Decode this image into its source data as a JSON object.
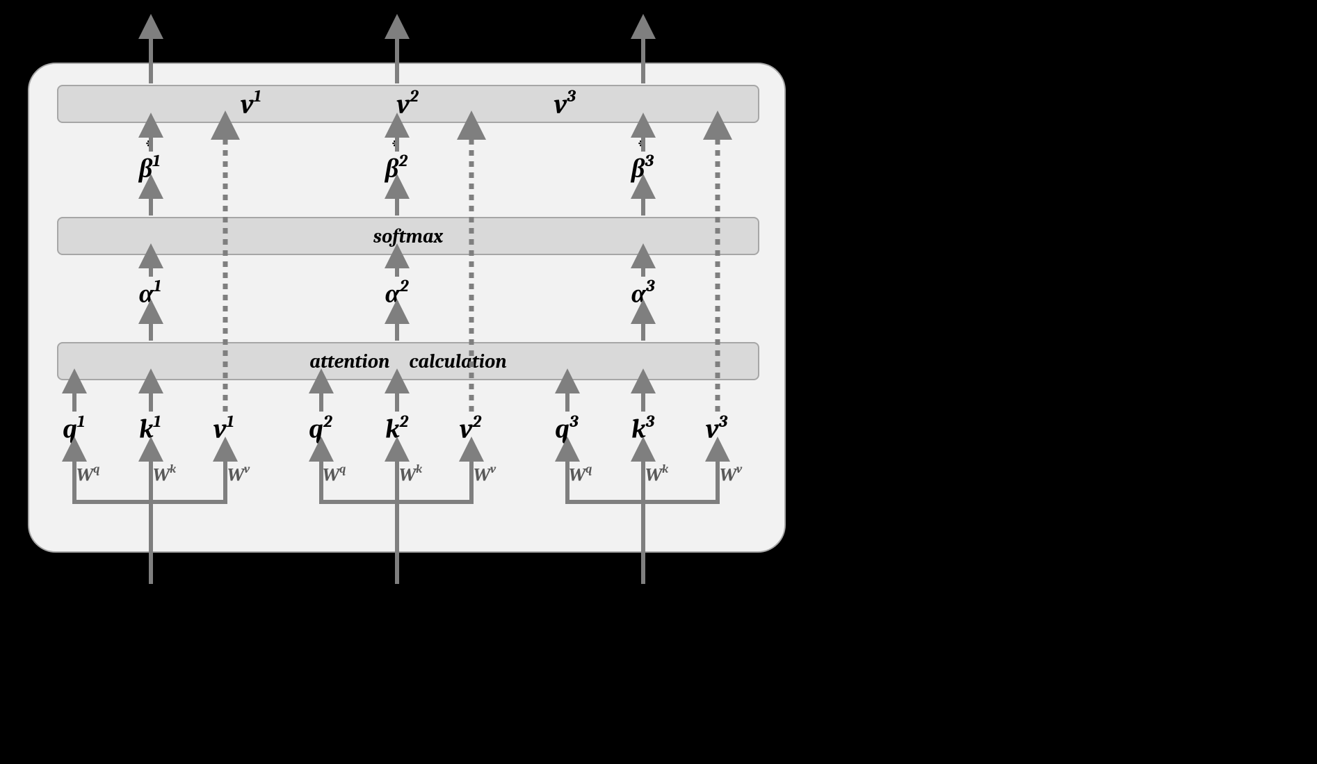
{
  "boxes": {
    "softmax_label": "softmax",
    "attention_label": "attention calculation"
  },
  "outputs": {
    "v1": {
      "base": "v",
      "sup": "1"
    },
    "v2": {
      "base": "v",
      "sup": "2"
    },
    "v3": {
      "base": "v",
      "sup": "3"
    }
  },
  "betas": {
    "b1": {
      "base": "β",
      "sup": "1"
    },
    "b2": {
      "base": "β",
      "sup": "2"
    },
    "b3": {
      "base": "β",
      "sup": "3"
    }
  },
  "alphas": {
    "a1": {
      "base": "α",
      "sup": "1"
    },
    "a2": {
      "base": "α",
      "sup": "2"
    },
    "a3": {
      "base": "α",
      "sup": "3"
    }
  },
  "qkv": {
    "q1": {
      "base": "q",
      "sup": "1"
    },
    "k1": {
      "base": "k",
      "sup": "1"
    },
    "v1": {
      "base": "v",
      "sup": "1"
    },
    "q2": {
      "base": "q",
      "sup": "2"
    },
    "k2": {
      "base": "k",
      "sup": "2"
    },
    "v2": {
      "base": "v",
      "sup": "2"
    },
    "q3": {
      "base": "q",
      "sup": "3"
    },
    "k3": {
      "base": "k",
      "sup": "3"
    },
    "v3": {
      "base": "v",
      "sup": "3"
    }
  },
  "weights": {
    "Wq": {
      "base": "W",
      "sup": "q"
    },
    "Wk": {
      "base": "W",
      "sup": "k"
    },
    "Wv": {
      "base": "W",
      "sup": "v"
    }
  },
  "asterisk": "*"
}
